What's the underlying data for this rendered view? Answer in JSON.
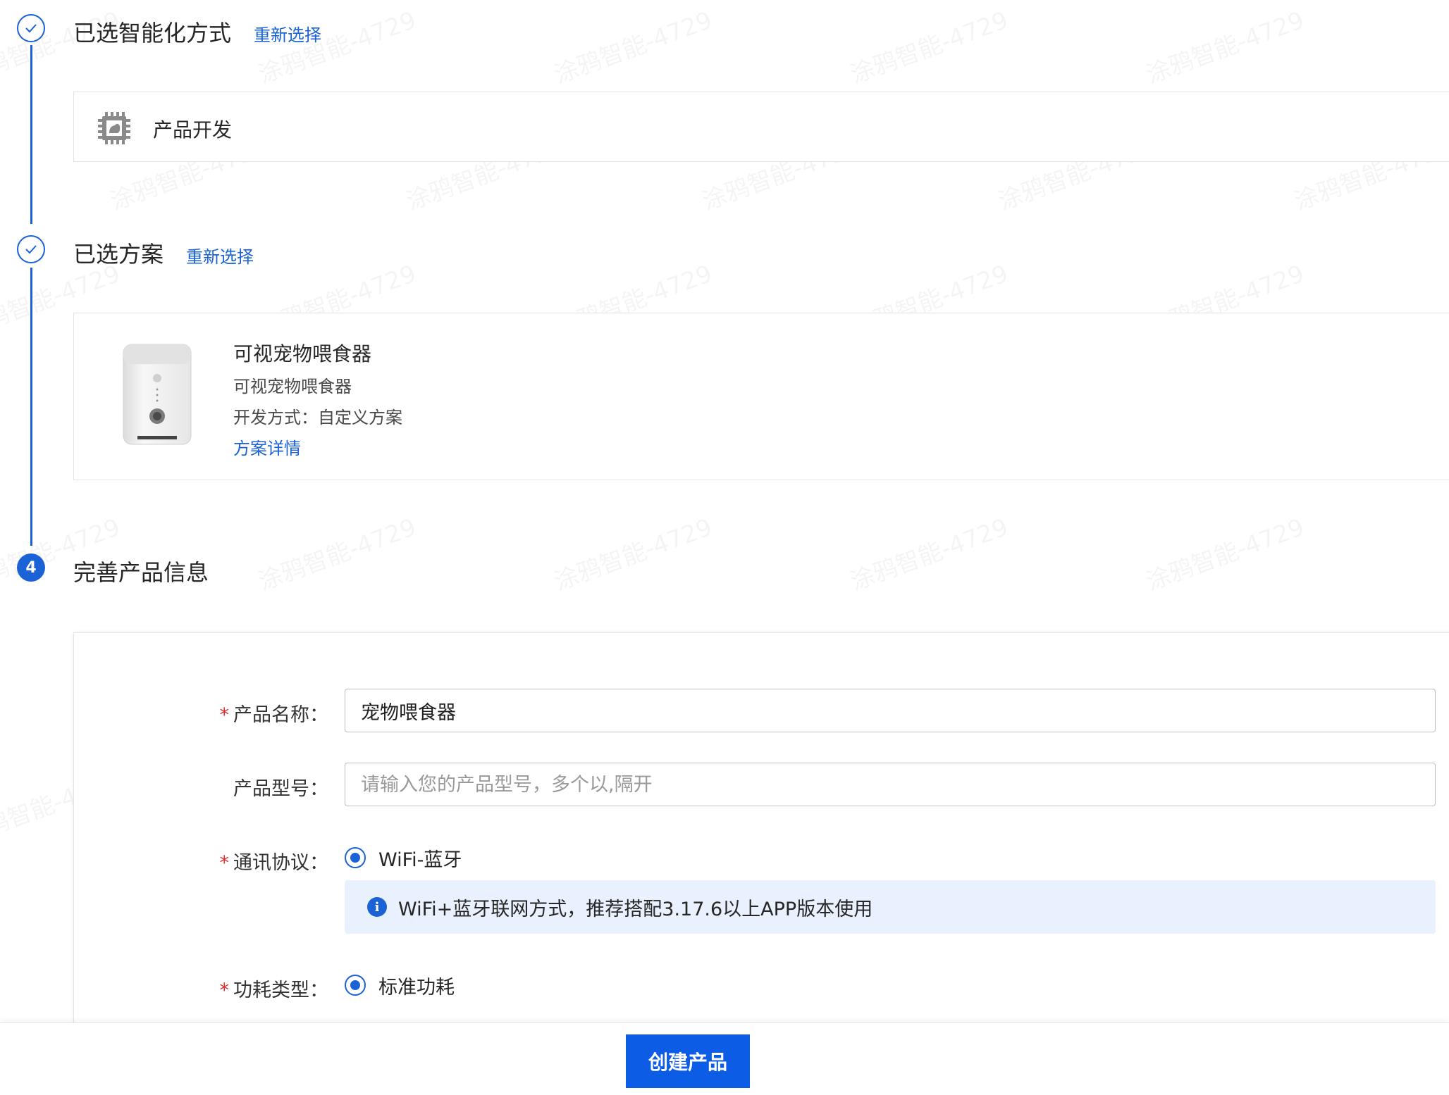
{
  "steps": {
    "method": {
      "title": "已选智能化方式",
      "reselect": "重新选择",
      "card_label": "产品开发"
    },
    "solution": {
      "title": "已选方案",
      "reselect": "重新选择",
      "name": "可视宠物喂食器",
      "subtitle": "可视宠物喂食器",
      "dev_mode": "开发方式：自定义方案",
      "details_link": "方案详情"
    },
    "info": {
      "number": "4",
      "title": "完善产品信息"
    }
  },
  "form": {
    "product_name": {
      "label": "产品名称：",
      "required": "*",
      "value": "宠物喂食器"
    },
    "product_model": {
      "label": "产品型号：",
      "placeholder": "请输入您的产品型号，多个以,隔开"
    },
    "protocol": {
      "label": "通讯协议：",
      "required": "*",
      "option": "WiFi-蓝牙"
    },
    "protocol_tip": {
      "icon": "info-icon",
      "text": "WiFi+蓝牙联网方式，推荐搭配3.17.6以上APP版本使用"
    },
    "power": {
      "label": "功耗类型：",
      "required": "*",
      "option": "标准功耗"
    }
  },
  "footer": {
    "create_label": "创建产品"
  },
  "watermark": {
    "text": "涂鸦智能-4729"
  },
  "colors": {
    "accent": "#1a62d6",
    "button": "#0d5ce6",
    "required": "#e02b2b",
    "tip_bg": "#e8f1fd"
  }
}
